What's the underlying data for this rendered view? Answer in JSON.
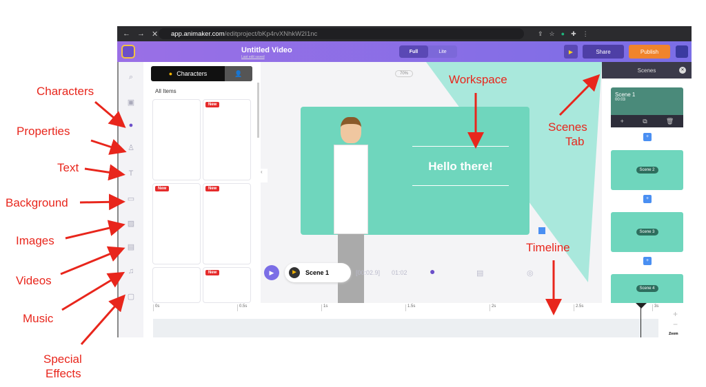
{
  "browser": {
    "url_host": "app.animaker.com",
    "url_path": "/editproject/bKp4rvXNhkW2I1nc"
  },
  "header": {
    "title": "Untitled Video",
    "subtitle": "Last edit saved",
    "mode_full": "Full",
    "mode_lite": "Lite",
    "share": "Share",
    "publish": "Publish",
    "accent": "#f0842c"
  },
  "panel": {
    "tab_characters": "Characters",
    "section": "All Items",
    "new_badge": "New"
  },
  "workspace": {
    "zoom": "70%",
    "canvas_text": "Hello there!",
    "scene_name": "Scene 1",
    "duration": "[00:02.9]",
    "time": "01:02"
  },
  "scenes": {
    "title": "Scenes",
    "items": [
      {
        "label": "Scene 1",
        "time": "00:03"
      },
      {
        "label": "Scene 2"
      },
      {
        "label": "Scene 3"
      },
      {
        "label": "Scene 4"
      }
    ],
    "add": "+"
  },
  "timeline": {
    "ticks": [
      "0s",
      "0.5s",
      "1s",
      "1.5s",
      "2s",
      "2.5s",
      "3s"
    ],
    "zoom_label": "Zoom"
  },
  "annotations": {
    "characters": "Characters",
    "properties": "Properties",
    "text": "Text",
    "background": "Background",
    "images": "Images",
    "videos": "Videos",
    "music": "Music",
    "special_effects_1": "Special",
    "special_effects_2": "Effects",
    "workspace": "Workspace",
    "scenes_tab_1": "Scenes",
    "scenes_tab_2": "Tab",
    "timeline": "Timeline"
  }
}
